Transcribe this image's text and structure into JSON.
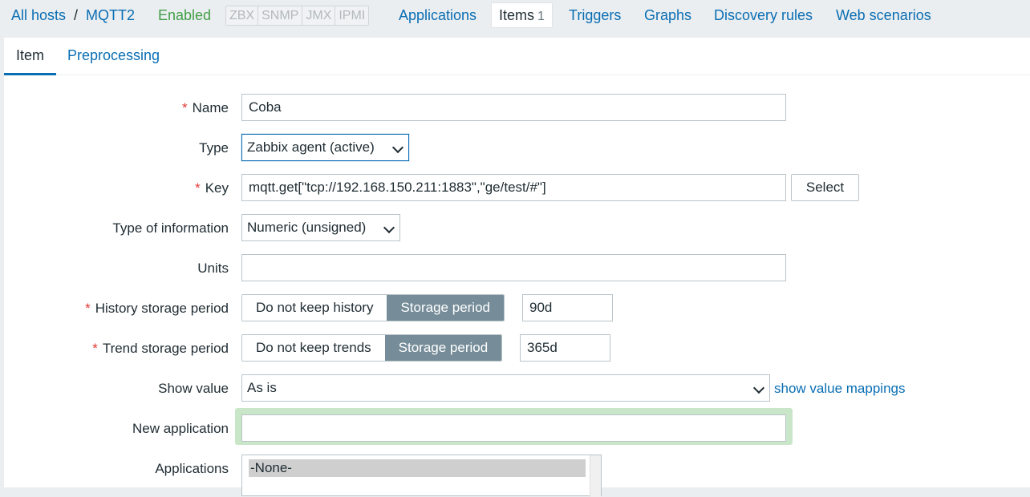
{
  "host_nav": {
    "all_hosts": "All hosts",
    "separator": "/",
    "host_name": "MQTT2",
    "status": "Enabled",
    "availability": [
      "ZBX",
      "SNMP",
      "JMX",
      "IPMI"
    ],
    "tabs": [
      {
        "label": "Applications"
      },
      {
        "label": "Items",
        "count": "1"
      },
      {
        "label": "Triggers"
      },
      {
        "label": "Graphs"
      },
      {
        "label": "Discovery rules"
      },
      {
        "label": "Web scenarios"
      }
    ]
  },
  "form_tabs": {
    "item": "Item",
    "preprocessing": "Preprocessing"
  },
  "form": {
    "name": {
      "label": "Name",
      "value": "Coba",
      "required_mark": "*"
    },
    "type": {
      "label": "Type",
      "value": "Zabbix agent (active)"
    },
    "key": {
      "label": "Key",
      "value": "mqtt.get[\"tcp://192.168.150.211:1883\",\"ge/test/#\"]",
      "required_mark": "*",
      "select_button": "Select"
    },
    "type_of_information": {
      "label": "Type of information",
      "value": "Numeric (unsigned)"
    },
    "units": {
      "label": "Units",
      "value": ""
    },
    "history": {
      "label": "History storage period",
      "required_mark": "*",
      "option_off": "Do not keep history",
      "option_on": "Storage period",
      "value": "90d"
    },
    "trends": {
      "label": "Trend storage period",
      "required_mark": "*",
      "option_off": "Do not keep trends",
      "option_on": "Storage period",
      "value": "365d"
    },
    "show_value": {
      "label": "Show value",
      "value": "As is",
      "link": "show value mappings"
    },
    "new_application": {
      "label": "New application",
      "value": ""
    },
    "applications": {
      "label": "Applications",
      "options": [
        "-None-"
      ]
    }
  },
  "colors": {
    "link": "#0a6eb4",
    "enabled": "#429e47",
    "required": "#e33734",
    "segment_active": "#768d99",
    "focus_ring": "#c9e6c9"
  }
}
